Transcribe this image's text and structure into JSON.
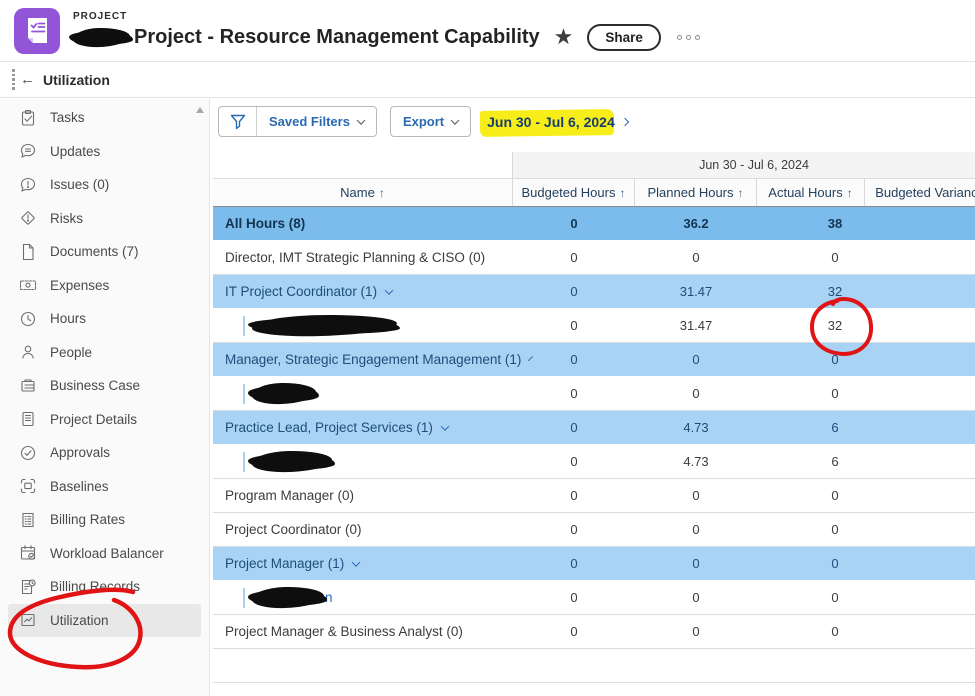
{
  "app": {
    "eyebrow": "PROJECT",
    "title": "Project - Resource Management Capability",
    "title_prefix_redacted": true,
    "share_label": "Share",
    "subnav_title": "Utilization"
  },
  "toolbar": {
    "saved_filters_label": "Saved Filters",
    "export_label": "Export",
    "date_range": "Jun 30 - Jul 6, 2024"
  },
  "sidebar": {
    "items": [
      {
        "label": "Tasks",
        "icon": "tasks-icon"
      },
      {
        "label": "Updates",
        "icon": "updates-icon"
      },
      {
        "label": "Issues (0)",
        "icon": "issues-icon"
      },
      {
        "label": "Risks",
        "icon": "risks-icon"
      },
      {
        "label": "Documents (7)",
        "icon": "documents-icon"
      },
      {
        "label": "Expenses",
        "icon": "expenses-icon"
      },
      {
        "label": "Hours",
        "icon": "hours-icon"
      },
      {
        "label": "People",
        "icon": "people-icon"
      },
      {
        "label": "Business Case",
        "icon": "business-case-icon"
      },
      {
        "label": "Project Details",
        "icon": "project-details-icon"
      },
      {
        "label": "Approvals",
        "icon": "approvals-icon"
      },
      {
        "label": "Baselines",
        "icon": "baselines-icon"
      },
      {
        "label": "Billing Rates",
        "icon": "billing-rates-icon"
      },
      {
        "label": "Workload Balancer",
        "icon": "workload-balancer-icon"
      },
      {
        "label": "Billing Records",
        "icon": "billing-records-icon"
      },
      {
        "label": "Utilization",
        "icon": "utilization-icon",
        "selected": true
      }
    ]
  },
  "table": {
    "period_label": "Jun 30 - Jul 6, 2024",
    "columns": [
      {
        "label": "Name",
        "sort": "↑"
      },
      {
        "label": "Budgeted Hours",
        "sort": "↑"
      },
      {
        "label": "Planned Hours",
        "sort": "↑"
      },
      {
        "label": "Actual Hours",
        "sort": "↑"
      },
      {
        "label": "Budgeted Variance",
        "sort": ""
      }
    ],
    "rows": [
      {
        "name": "All Hours (8)",
        "style": "summary",
        "budgeted": "0",
        "planned": "36.2",
        "actual": "38",
        "variance": ""
      },
      {
        "name": "Director, IMT Strategic Planning & CISO (0)",
        "style": "plain",
        "budgeted": "0",
        "planned": "0",
        "actual": "0",
        "variance": ""
      },
      {
        "name": "IT Project Coordinator (1)",
        "style": "group",
        "expandable": true,
        "budgeted": "0",
        "planned": "31.47",
        "actual": "32",
        "variance": ""
      },
      {
        "name": "",
        "style": "person",
        "redacted": true,
        "scribble_width": 145,
        "budgeted": "0",
        "planned": "31.47",
        "actual": "32",
        "variance": ""
      },
      {
        "name": "Manager, Strategic Engagement Management (1)",
        "style": "group",
        "expandable": true,
        "budgeted": "0",
        "planned": "0",
        "actual": "0",
        "variance": ""
      },
      {
        "name": "",
        "style": "person",
        "redacted": true,
        "scribble_width": 64,
        "budgeted": "0",
        "planned": "0",
        "actual": "0",
        "variance": ""
      },
      {
        "name": "Practice Lead, Project Services (1)",
        "style": "group",
        "expandable": true,
        "budgeted": "0",
        "planned": "4.73",
        "actual": "6",
        "variance": ""
      },
      {
        "name": "",
        "style": "person",
        "redacted": true,
        "scribble_width": 80,
        "budgeted": "0",
        "planned": "4.73",
        "actual": "6",
        "variance": ""
      },
      {
        "name": "Program Manager (0)",
        "style": "plain",
        "budgeted": "0",
        "planned": "0",
        "actual": "0",
        "variance": ""
      },
      {
        "name": "Project Coordinator (0)",
        "style": "plain",
        "budgeted": "0",
        "planned": "0",
        "actual": "0",
        "variance": ""
      },
      {
        "name": "Project Manager (1)",
        "style": "group",
        "expandable": true,
        "budgeted": "0",
        "planned": "0",
        "actual": "0",
        "variance": ""
      },
      {
        "name": "",
        "style": "person",
        "redacted": true,
        "scribble_width": 72,
        "name_suffix": "n",
        "budgeted": "0",
        "planned": "0",
        "actual": "0",
        "variance": ""
      },
      {
        "name": "Project Manager & Business Analyst (0)",
        "style": "plain",
        "budgeted": "0",
        "planned": "0",
        "actual": "0",
        "variance": ""
      }
    ]
  },
  "annotations": {
    "highlight_color": "#f7ee19",
    "marker_color": "#e01414",
    "redaction_color": "#0e0e0e",
    "yellow_highlight_target": "date-range",
    "red_circle_targets": [
      "sidebar-item-utilization",
      "actual-hours-value-32"
    ],
    "black_redaction_targets": [
      "project-code-in-title",
      "person-name-rows"
    ]
  }
}
